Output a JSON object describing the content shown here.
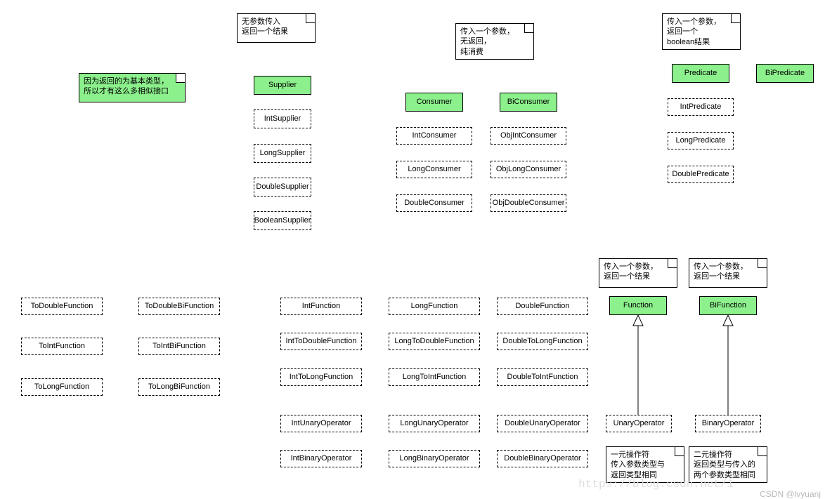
{
  "notes": {
    "green1": "因为返回的为基本类型，\n所以才有这么多相似接口",
    "supplier": "无参数传入\n返回一个结果",
    "consumer": "传入一个参数，\n无返回，\n纯消费",
    "predicate": "传入一个参数，\n返回一个\nboolean结果",
    "function": "传入一个参数，\n返回一个结果",
    "bifunction": "传入一个参数，\n返回一个结果",
    "unary": "一元操作符\n传入参数类型与\n返回类型相同",
    "binary": "二元操作符\n返回类型与传入的\n两个参数类型相同"
  },
  "green": {
    "supplier": "Supplier",
    "consumer": "Consumer",
    "biconsumer": "BiConsumer",
    "predicate": "Predicate",
    "bipredicate": "BiPredicate",
    "function": "Function",
    "bifunction": "BiFunction"
  },
  "d": {
    "intSupplier": "IntSupplier",
    "longSupplier": "LongSupplier",
    "doubleSupplier": "DoubleSupplier",
    "booleanSupplier": "BooleanSupplier",
    "intConsumer": "IntConsumer",
    "longConsumer": "LongConsumer",
    "doubleConsumer": "DoubleConsumer",
    "objIntConsumer": "ObjIntConsumer",
    "objLongConsumer": "ObjLongConsumer",
    "objDoubleConsumer": "ObjDoubleConsumer",
    "intPredicate": "IntPredicate",
    "longPredicate": "LongPredicate",
    "doublePredicate": "DoublePredicate",
    "toDoubleFunction": "ToDoubleFunction",
    "toIntFunction": "ToIntFunction",
    "toLongFunction": "ToLongFunction",
    "toDoubleBiFunction": "ToDoubleBiFunction",
    "toIntBiFunction": "ToIntBiFunction",
    "toLongBiFunction": "ToLongBiFunction",
    "intFunction": "IntFunction",
    "intToDoubleFunction": "IntToDoubleFunction",
    "intToLongFunction": "IntToLongFunction",
    "intUnaryOperator": "IntUnaryOperator",
    "intBinaryOperator": "IntBinaryOperator",
    "longFunction": "LongFunction",
    "longToDoubleFunction": "LongToDoubleFunction",
    "longToIntFunction": "LongToIntFunction",
    "longUnaryOperator": "LongUnaryOperator",
    "longBinaryOperator": "LongBinaryOperator",
    "doubleFunction": "DoubleFunction",
    "doubleToLongFunction": "DoubleToLongFunction",
    "doubleToIntFunction": "DoubleToIntFunction",
    "doubleUnaryOperator": "DoubleUnaryOperator",
    "doubleBinaryOperator": "DoubleBinaryOperator",
    "unaryOperator": "UnaryOperator",
    "binaryOperator": "BinaryOperator"
  },
  "watermark": "CSDN @lvyuanj",
  "watermark2": "https://blog.csdn.net/1"
}
